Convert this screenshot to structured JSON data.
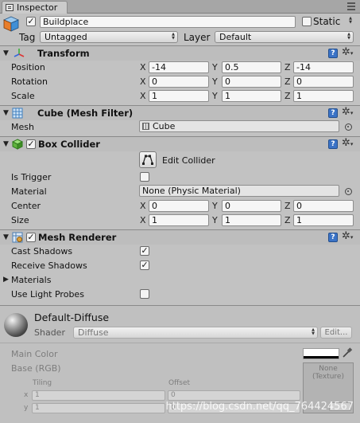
{
  "window": {
    "tab_label": "Inspector"
  },
  "object": {
    "name": "Buildplace",
    "static_label": "Static",
    "tag_label": "Tag",
    "tag_value": "Untagged",
    "layer_label": "Layer",
    "layer_value": "Default"
  },
  "transform": {
    "title": "Transform",
    "rows": [
      {
        "label": "Position",
        "x": "-14",
        "y": "0.5",
        "z": "-14"
      },
      {
        "label": "Rotation",
        "x": "0",
        "y": "0",
        "z": "0"
      },
      {
        "label": "Scale",
        "x": "1",
        "y": "1",
        "z": "1"
      }
    ],
    "axes": [
      "X",
      "Y",
      "Z"
    ]
  },
  "mesh_filter": {
    "title": "Cube (Mesh Filter)",
    "mesh_label": "Mesh",
    "mesh_value": "Cube"
  },
  "box_collider": {
    "title": "Box Collider",
    "edit_label": "Edit Collider",
    "is_trigger_label": "Is Trigger",
    "material_label": "Material",
    "material_value": "None (Physic Material)",
    "center_label": "Center",
    "center": {
      "x": "0",
      "y": "0",
      "z": "0"
    },
    "size_label": "Size",
    "size": {
      "x": "1",
      "y": "1",
      "z": "1"
    }
  },
  "mesh_renderer": {
    "title": "Mesh Renderer",
    "cast_shadows_label": "Cast Shadows",
    "receive_shadows_label": "Receive Shadows",
    "materials_label": "Materials",
    "light_probes_label": "Use Light Probes"
  },
  "material": {
    "name": "Default-Diffuse",
    "shader_label": "Shader",
    "shader_value": "Diffuse",
    "edit_label": "Edit...",
    "main_color_label": "Main Color",
    "base_label": "Base (RGB)",
    "texture_none": "None",
    "texture_type": "(Texture)",
    "tiling_label": "Tiling",
    "offset_label": "Offset",
    "x_label": "x",
    "y_label": "y",
    "tiling_x": "1",
    "tiling_y": "1",
    "offset_x": "0",
    "offset_y": "0"
  },
  "watermark": "https://blog.csdn.net/qq_764424567"
}
